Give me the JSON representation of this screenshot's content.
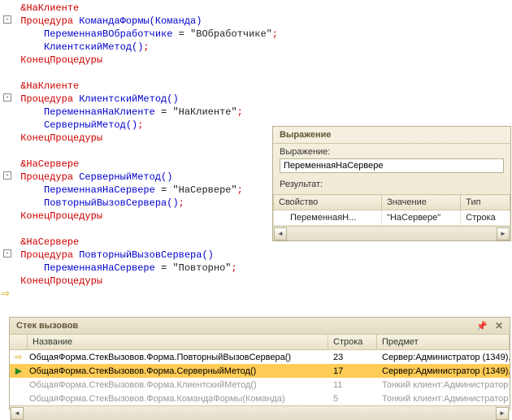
{
  "code": {
    "blocks": [
      {
        "directive": "&НаКлиенте",
        "proc_kw": "Процедура",
        "proc_name": "КомандаФормы",
        "proc_args": "(Команда)",
        "lines": [
          {
            "var": "ПеременнаяВОбработчике",
            "assign": " = ",
            "value": "\"ВОбработчике\"",
            "semi": ";"
          },
          {
            "call": "КлиентскийМетод",
            "parens": "()",
            "semi": ";"
          }
        ],
        "end_kw": "КонецПроцедуры"
      },
      {
        "directive": "&НаКлиенте",
        "proc_kw": "Процедура",
        "proc_name": "КлиентскийМетод",
        "proc_args": "()",
        "lines": [
          {
            "var": "ПеременнаяНаКлиенте",
            "assign": " = ",
            "value": "\"НаКлиенте\"",
            "semi": ";"
          },
          {
            "call": "СерверныйМетод",
            "parens": "()",
            "semi": ";"
          }
        ],
        "end_kw": "КонецПроцедуры"
      },
      {
        "directive": "&НаСервере",
        "proc_kw": "Процедура",
        "proc_name": "СерверныйМетод",
        "proc_args": "()",
        "lines": [
          {
            "var": "ПеременнаяНаСервере",
            "assign": " = ",
            "value": "\"НаСервере\"",
            "semi": ";"
          },
          {
            "call": "ПовторныйВызовСервера",
            "parens": "()",
            "semi": ";"
          }
        ],
        "end_kw": "КонецПроцедуры"
      },
      {
        "directive": "&НаСервере",
        "proc_kw": "Процедура",
        "proc_name": "ПовторныйВызовСервера",
        "proc_args": "()",
        "lines": [
          {
            "var": "ПеременнаяНаСервере",
            "assign": " = ",
            "value": "\"Повторно\"",
            "semi": ";"
          }
        ],
        "end_kw": "КонецПроцедуры"
      }
    ]
  },
  "expr": {
    "title": "Выражение",
    "label_expr": "Выражение:",
    "input_value": "ПеременнаяНаСервере",
    "label_result": "Результат:",
    "cols": {
      "prop": "Свойство",
      "val": "Значение",
      "type": "Тип"
    },
    "row": {
      "prop": "ПеременнаяН...",
      "val": "\"НаСервере\"",
      "type": "Строка"
    }
  },
  "stack": {
    "title": "Стек вызовов",
    "cols": {
      "name": "Название",
      "line": "Строка",
      "subj": "Предмет"
    },
    "rows": [
      {
        "icon": "⇨",
        "name": "ОбщаяФорма.СтекВызовов.Форма.ПовторныйВызовСервера()",
        "line": "23",
        "subj": "Сервер:Администратор (1349),",
        "dim": false,
        "sel": false
      },
      {
        "icon": "▶",
        "name": "ОбщаяФорма.СтекВызовов.Форма.СерверныйМетод()",
        "line": "17",
        "subj": "Сервер:Администратор (1349),",
        "dim": false,
        "sel": true
      },
      {
        "icon": "",
        "name": "ОбщаяФорма.СтекВызовов.Форма.КлиентскийМетод()",
        "line": "11",
        "subj": "Тонкий клиент:Администратор",
        "dim": true,
        "sel": false
      },
      {
        "icon": "",
        "name": "ОбщаяФорма.СтекВызовов.Форма.КомандаФормы(Команда)",
        "line": "5",
        "subj": "Тонкий клиент:Администратор",
        "dim": true,
        "sel": false
      }
    ]
  }
}
